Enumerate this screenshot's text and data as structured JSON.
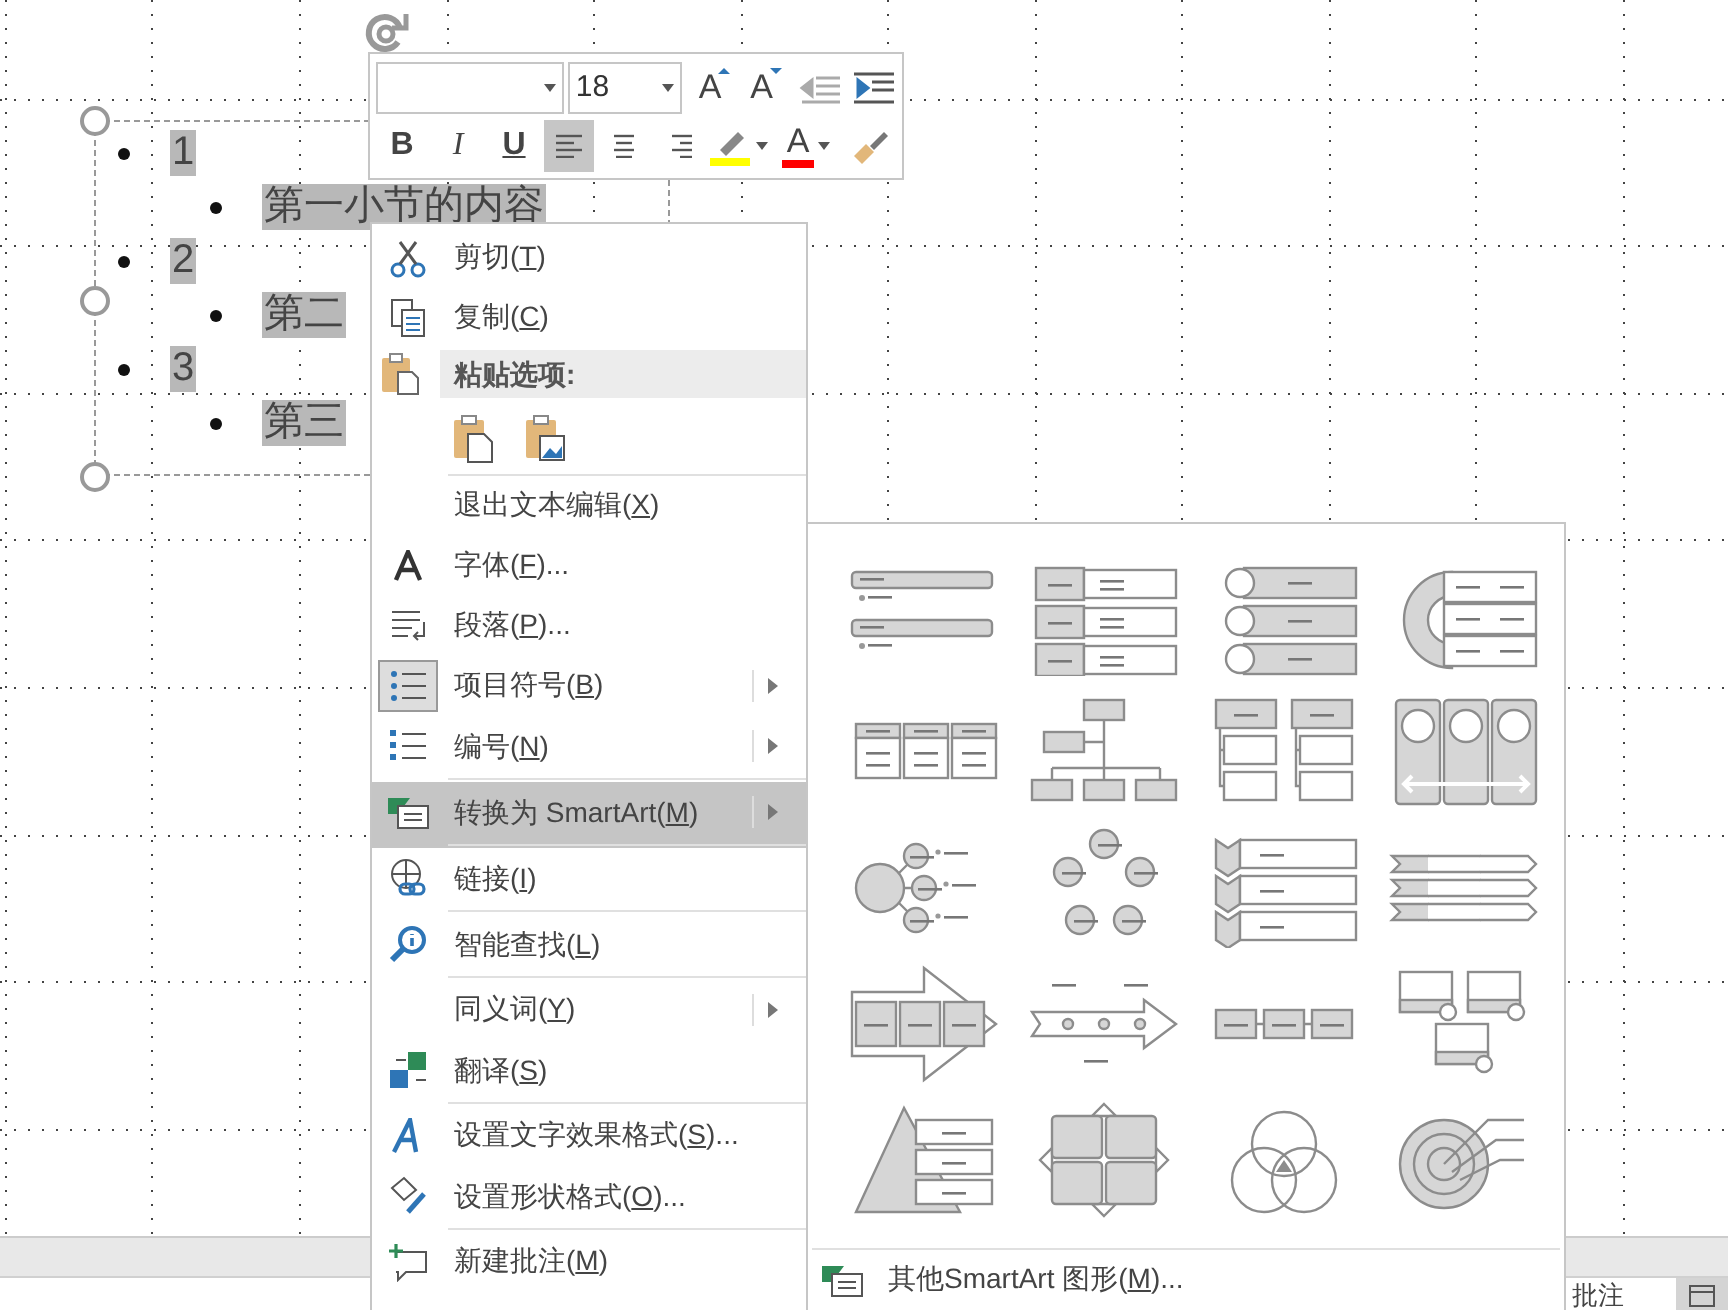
{
  "textbox": {
    "items": [
      {
        "text": "1",
        "selected": true,
        "children": [
          {
            "text": "第一小节的内容",
            "selected": true
          }
        ]
      },
      {
        "text": "2",
        "selected": true,
        "children": [
          {
            "text": "第二",
            "selected": true
          }
        ]
      },
      {
        "text": "3",
        "selected": true,
        "children": [
          {
            "text": "第三",
            "selected": true
          }
        ]
      }
    ]
  },
  "mini_toolbar": {
    "font_size": "18",
    "grow_font": "A",
    "shrink_font": "A",
    "format_buttons": [
      {
        "label": "B",
        "kind": "bold"
      },
      {
        "label": "I",
        "kind": "italic"
      },
      {
        "label": "U",
        "kind": "underline"
      }
    ],
    "align_buttons": [
      {
        "selected": true
      },
      {
        "selected": false
      },
      {
        "selected": false
      }
    ],
    "font_color_label": "A"
  },
  "context_menu": [
    {
      "kind": "item",
      "before": "剪切(",
      "key": "T",
      "after": ")",
      "selected": false,
      "checked": false,
      "submenu": false,
      "separator_after": false
    },
    {
      "kind": "item",
      "before": "复制(",
      "key": "C",
      "after": ")",
      "selected": false,
      "checked": false,
      "submenu": false,
      "separator_after": false
    },
    {
      "kind": "header",
      "before": "粘贴选项:"
    },
    {
      "kind": "paste-options",
      "separator_after": true
    },
    {
      "kind": "item",
      "before": "退出文本编辑(",
      "key": "X",
      "after": ")",
      "selected": false,
      "checked": false,
      "submenu": false,
      "separator_after": false
    },
    {
      "kind": "item",
      "before": "字体(",
      "key": "F",
      "after": ")...",
      "selected": false,
      "checked": false,
      "submenu": false,
      "separator_after": false
    },
    {
      "kind": "item",
      "before": "段落(",
      "key": "P",
      "after": ")...",
      "selected": false,
      "checked": false,
      "submenu": false,
      "separator_after": false
    },
    {
      "kind": "item",
      "before": "项目符号(",
      "key": "B",
      "after": ")",
      "selected": false,
      "checked": true,
      "submenu": true,
      "separator_after": false
    },
    {
      "kind": "item",
      "before": "编号(",
      "key": "N",
      "after": ")",
      "selected": false,
      "checked": false,
      "submenu": true,
      "separator_after": true
    },
    {
      "kind": "item",
      "before": "转换为 SmartArt(",
      "key": "M",
      "after": ")",
      "selected": true,
      "checked": false,
      "submenu": true,
      "separator_after": true
    },
    {
      "kind": "item",
      "before": "链接(",
      "key": "I",
      "after": ")",
      "selected": false,
      "checked": false,
      "submenu": false,
      "separator_after": true
    },
    {
      "kind": "item",
      "before": "智能查找(",
      "key": "L",
      "after": ")",
      "selected": false,
      "checked": false,
      "submenu": false,
      "separator_after": true
    },
    {
      "kind": "item",
      "before": "同义词(",
      "key": "Y",
      "after": ")",
      "selected": false,
      "checked": false,
      "submenu": true,
      "separator_after": false
    },
    {
      "kind": "item",
      "before": "翻译(",
      "key": "S",
      "after": ")",
      "selected": false,
      "checked": false,
      "submenu": false,
      "separator_after": true
    },
    {
      "kind": "item",
      "before": "设置文字效果格式(",
      "key": "S",
      "after": ")...",
      "selected": false,
      "checked": false,
      "submenu": false,
      "separator_after": false
    },
    {
      "kind": "item",
      "before": "设置形状格式(",
      "key": "O",
      "after": ")...",
      "selected": false,
      "checked": false,
      "submenu": false,
      "separator_after": true
    },
    {
      "kind": "item",
      "before": "新建批注(",
      "key": "M",
      "after": ")",
      "selected": false,
      "checked": false,
      "submenu": false,
      "separator_after": false
    }
  ],
  "smartart_submenu": {
    "more_before": "其他SmartArt 图形(",
    "more_key": "M",
    "more_after": ")..."
  },
  "status_bar": {
    "comments": "批注"
  }
}
